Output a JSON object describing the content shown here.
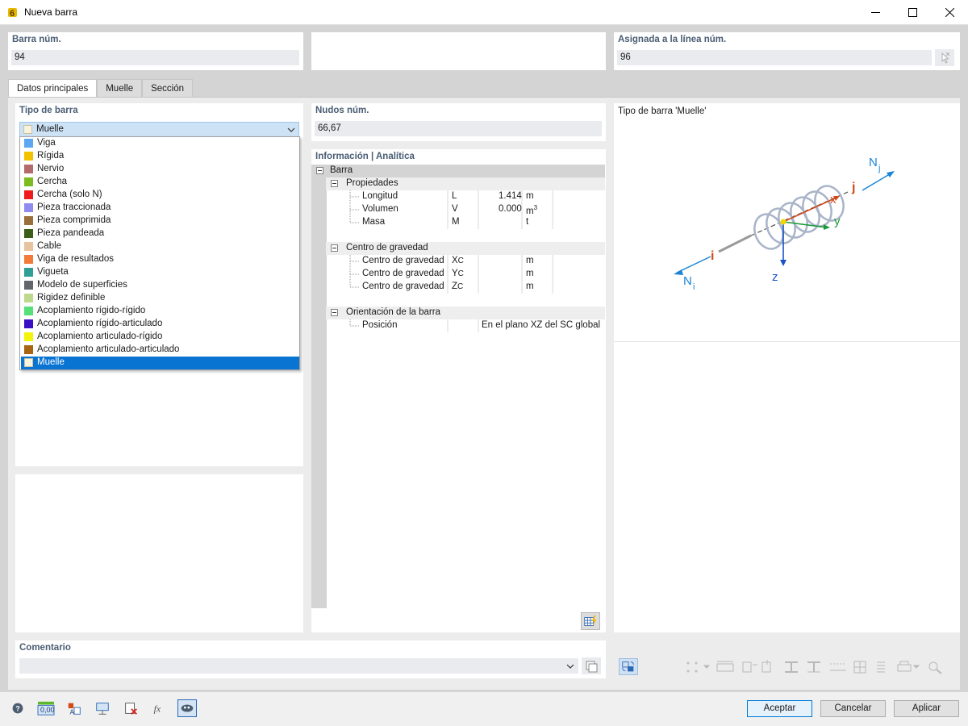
{
  "window": {
    "title": "Nueva barra"
  },
  "barra": {
    "label": "Barra núm.",
    "value": "94"
  },
  "asignada": {
    "label": "Asignada a la línea núm.",
    "value": "96"
  },
  "tabs": [
    {
      "label": "Datos principales"
    },
    {
      "label": "Muelle"
    },
    {
      "label": "Sección"
    }
  ],
  "tipo": {
    "label": "Tipo de barra",
    "selected": "Muelle",
    "selected_color": "#f7f3dc",
    "options": [
      {
        "label": "Viga",
        "color": "#5da7f2"
      },
      {
        "label": "Rígida",
        "color": "#f2c200"
      },
      {
        "label": "Nervio",
        "color": "#b46b6e"
      },
      {
        "label": "Cercha",
        "color": "#7dbb1e"
      },
      {
        "label": "Cercha (solo N)",
        "color": "#ee1c1c"
      },
      {
        "label": "Pieza traccionada",
        "color": "#8f8cf0"
      },
      {
        "label": "Pieza comprimida",
        "color": "#9a6f3a"
      },
      {
        "label": "Pieza pandeada",
        "color": "#3c5e1a"
      },
      {
        "label": "Cable",
        "color": "#e8c3a0"
      },
      {
        "label": "Viga de resultados",
        "color": "#f27b3b"
      },
      {
        "label": "Vigueta",
        "color": "#2f9e94"
      },
      {
        "label": "Modelo de superficies",
        "color": "#62666b"
      },
      {
        "label": "Rigidez definible",
        "color": "#bcd98e"
      },
      {
        "label": "Acoplamiento rígido-rígido",
        "color": "#55e07a"
      },
      {
        "label": "Acoplamiento rígido-articulado",
        "color": "#3a0fc4"
      },
      {
        "label": "Acoplamiento articulado-rígido",
        "color": "#f4f40a"
      },
      {
        "label": "Acoplamiento articulado-articulado",
        "color": "#a86410"
      },
      {
        "label": "Muelle",
        "color": "#f7f3dc"
      }
    ]
  },
  "nudos": {
    "label": "Nudos núm.",
    "value": "66,67"
  },
  "info": {
    "label": "Información | Analítica",
    "barra": "Barra",
    "propiedades": "Propiedades",
    "props": [
      {
        "name": "Longitud",
        "sym": "L",
        "value": "1.414",
        "unit": "m",
        "sup": ""
      },
      {
        "name": "Volumen",
        "sym": "V",
        "value": "0.000",
        "unit": "m",
        "sup": "3"
      },
      {
        "name": "Masa",
        "sym": "M",
        "value": "",
        "unit": "t",
        "sup": ""
      }
    ],
    "centro": "Centro de gravedad",
    "centro_rows": [
      {
        "name": "Centro de gravedad",
        "sym": "X",
        "sub": "C",
        "unit": "m"
      },
      {
        "name": "Centro de gravedad",
        "sym": "Y",
        "sub": "C",
        "unit": "m"
      },
      {
        "name": "Centro de gravedad",
        "sym": "Z",
        "sub": "C",
        "unit": "m"
      }
    ],
    "orientacion": "Orientación de la barra",
    "posicion": {
      "name": "Posición",
      "value": "En el plano XZ del SC global"
    }
  },
  "preview": {
    "title": "Tipo de barra 'Muelle'",
    "labels": {
      "nj": "N",
      "nj_sub": "j",
      "ni": "N",
      "ni_sub": "i",
      "j": "j",
      "i": "i",
      "x": "x",
      "y": "y",
      "z": "z"
    }
  },
  "comentario": {
    "label": "Comentario",
    "value": ""
  },
  "buttons": {
    "ok": "Aceptar",
    "cancel": "Cancelar",
    "apply": "Aplicar"
  },
  "toolbar": {
    "units_label": "0,00"
  }
}
